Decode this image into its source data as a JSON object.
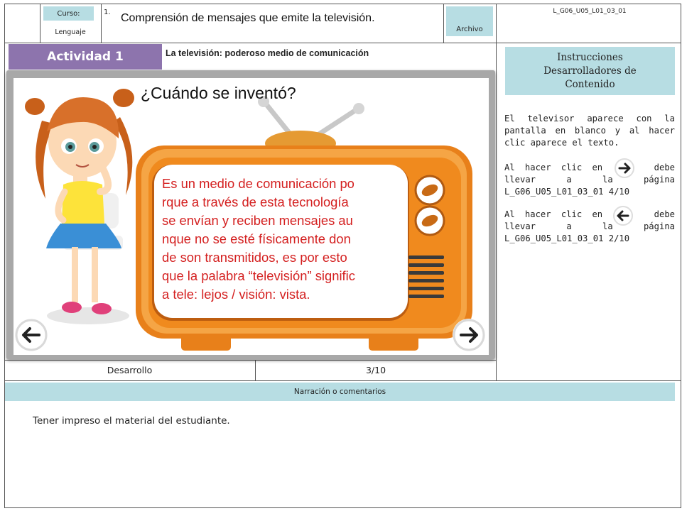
{
  "header": {
    "curso_label": "Curso:",
    "curso_value": "Lenguaje",
    "course_number": "1.",
    "title": "Comprensión de mensajes que emite la televisión.",
    "archivo_label": "Archivo",
    "doc_code": "L_G06_U05_L01_03_01"
  },
  "activity": {
    "badge": "Actividad 1",
    "title": "La televisión: poderoso medio de comunicación"
  },
  "slide": {
    "heading": "¿Cuándo se inventó?",
    "tv_text_lines": [
      "Es un medio de comunicación po",
      "rque a través de esta tecnología",
      "se envían y reciben mensajes au",
      "nque no se esté físicamente don",
      "de son transmitidos, es por esto",
      "que la palabra “televisión” signific",
      "a tele: lejos / visión: vista."
    ]
  },
  "footer": {
    "section": "Desarrollo",
    "page": "3/10"
  },
  "instructions": {
    "header": "Instrucciones\nDesarrolladores de\nContenido",
    "p1": "El televisor aparece con la pantalla en blanco y al hacer clic aparece el texto.",
    "p2_a": "Al hacer clic en",
    "p2_b": "debe llevar a la página L_G06_U05_L01_03_01 4/10",
    "p3_a": "Al hacer clic en",
    "p3_b": "debe llevar a la página L_G06_U05_L01_03_01 2/10"
  },
  "narration": {
    "header": "Narración o comentarios",
    "text": "Tener impreso el material del estudiante."
  },
  "icons": {
    "next": "arrow-right-icon",
    "prev": "arrow-left-icon"
  },
  "colors": {
    "accent_blue": "#b7dde3",
    "activity_purple": "#8d74ad",
    "tv_orange": "#f08a1e",
    "text_red": "#d42020"
  }
}
